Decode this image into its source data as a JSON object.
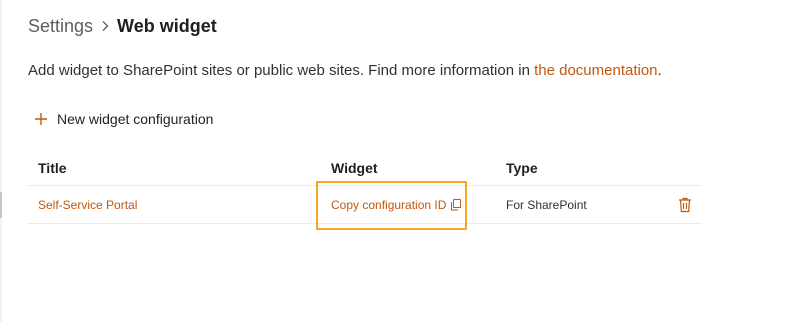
{
  "breadcrumb": {
    "root": "Settings",
    "current": "Web widget"
  },
  "description": {
    "text": "Add widget to SharePoint sites or public web sites. Find more information in ",
    "link": "the documentation",
    "suffix": "."
  },
  "toolbar": {
    "new_label": "New widget configuration",
    "icon": "plus-icon"
  },
  "table": {
    "headers": {
      "title": "Title",
      "widget": "Widget",
      "type": "Type"
    },
    "rows": [
      {
        "title": "Self-Service Portal",
        "widget": "Copy configuration ID",
        "type": "For SharePoint",
        "icons": [
          "copy-icon",
          "trash-icon"
        ]
      }
    ]
  },
  "colors": {
    "accent": "#c4560f",
    "highlight": "#f6a623",
    "text": "#323130"
  }
}
